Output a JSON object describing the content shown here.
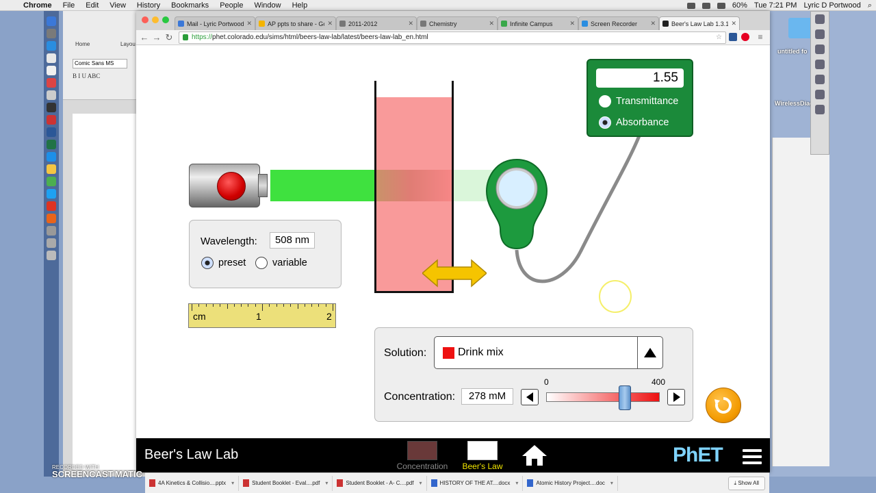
{
  "menubar": {
    "app": "Chrome",
    "items": [
      "File",
      "Edit",
      "View",
      "History",
      "Bookmarks",
      "People",
      "Window",
      "Help"
    ],
    "battery": "60%",
    "clock": "Tue 7:21 PM",
    "user": "Lyric D Portwood"
  },
  "word": {
    "home_tab": "Home",
    "layout_tab": "Layou",
    "font_name": "Comic Sans MS",
    "format": "B  I  U  ABC"
  },
  "desktop": {
    "folder_label": "untitled fo",
    "file_label": "WirelessDiag"
  },
  "browser": {
    "tabs": [
      {
        "label": "Mail - Lyric Portwood"
      },
      {
        "label": "AP ppts to share - Goo"
      },
      {
        "label": "2011-2012"
      },
      {
        "label": "Chemistry"
      },
      {
        "label": "Infinite Campus"
      },
      {
        "label": "Screen Recorder"
      },
      {
        "label": "Beer's Law Lab 1.3.1"
      }
    ],
    "url_scheme": "https://",
    "url_rest": "phet.colorado.edu/sims/html/beers-law-lab/latest/beers-law-lab_en.html"
  },
  "sim": {
    "meter": {
      "value": "1.55",
      "transmittance_label": "Transmittance",
      "absorbance_label": "Absorbance",
      "selected": "Absorbance"
    },
    "wavelength": {
      "label": "Wavelength:",
      "value": "508 nm",
      "preset_label": "preset",
      "variable_label": "variable",
      "selected": "preset"
    },
    "ruler": {
      "unit": "cm",
      "mark1": "1",
      "mark2": "2"
    },
    "solution": {
      "label": "Solution:",
      "selected": "Drink mix",
      "swatch_color": "#ee1111"
    },
    "concentration": {
      "label": "Concentration:",
      "value": "278 mM",
      "min_label": "0",
      "max_label": "400",
      "min": 0,
      "max": 400,
      "current": 278
    },
    "beam_color": "#3fe13f",
    "solution_color": "#f77878"
  },
  "navbar": {
    "title": "Beer's Law Lab",
    "screens": [
      {
        "label": "Concentration",
        "active": false
      },
      {
        "label": "Beer's Law",
        "active": true
      }
    ],
    "brand": "PhET"
  },
  "downloads": {
    "items": [
      {
        "label": "4A Kinetics & Collisio....pptx",
        "type": "ppt"
      },
      {
        "label": "Student Booklet - Eval....pdf",
        "type": "pdf"
      },
      {
        "label": "Student Booklet - A- C....pdf",
        "type": "pdf"
      },
      {
        "label": "HISTORY OF THE AT....docx",
        "type": "doc"
      },
      {
        "label": "Atomic History Project....doc",
        "type": "doc"
      }
    ],
    "show_all": "Show All"
  },
  "watermark": {
    "line1": "RECORDED WITH",
    "line2": "SCREENCAST",
    "line3": "MATIC"
  }
}
